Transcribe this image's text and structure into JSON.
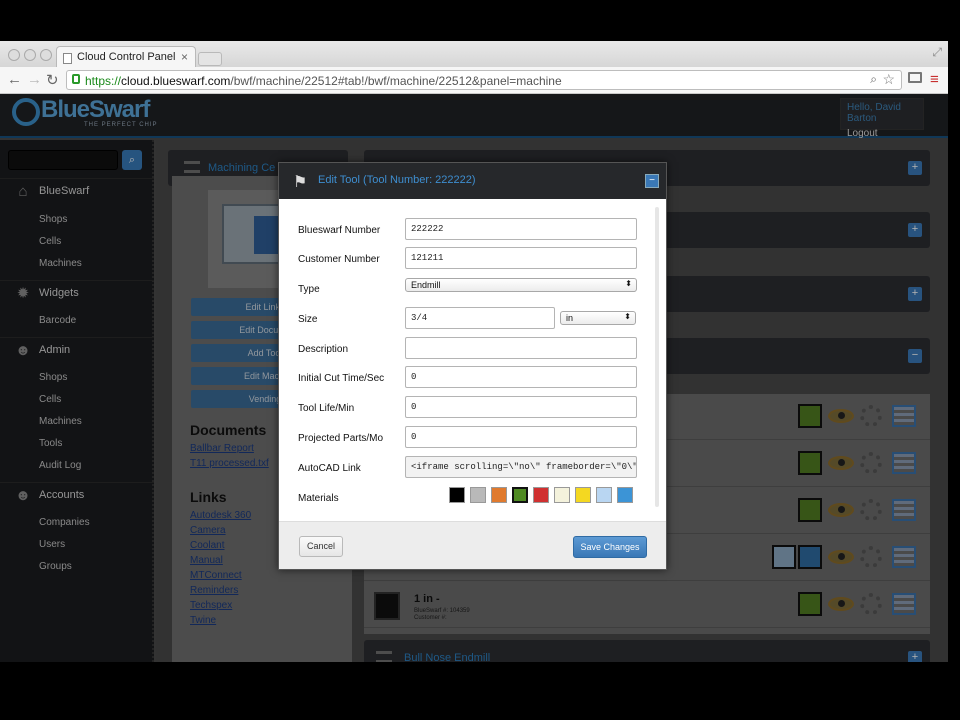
{
  "browser": {
    "tab_title": "Cloud Control Panel",
    "url_scheme": "https://",
    "url_host": "cloud.blueswarf.com",
    "url_path": "/bwf/machine/22512#tab!/bwf/machine/22512&panel=machine"
  },
  "header": {
    "logo_text": "BlueSwarf",
    "logo_tagline": "THE PERFECT CHIP",
    "greeting": "Hello, David Barton",
    "logout": "Logout"
  },
  "sidebar": {
    "sections": [
      {
        "label": "BlueSwarf",
        "icon": "home-icon",
        "items": [
          "Shops",
          "Cells",
          "Machines"
        ]
      },
      {
        "label": "Widgets",
        "icon": "gear-icon",
        "items": [
          "Barcode"
        ]
      },
      {
        "label": "Admin",
        "icon": "user-icon",
        "items": [
          "Shops",
          "Cells",
          "Machines",
          "Tools",
          "Audit Log"
        ]
      },
      {
        "label": "Accounts",
        "icon": "users-icon",
        "items": [
          "Companies",
          "Users",
          "Groups"
        ]
      }
    ]
  },
  "left_panel": {
    "title": "Machining Ce",
    "buttons": [
      "Edit Links",
      "Edit Docume",
      "Add Tool",
      "Edit Machi",
      "Vending"
    ],
    "documents_heading": "Documents",
    "documents": [
      "Ballbar Report",
      "T11 processed.txf"
    ],
    "links_heading": "Links",
    "links": [
      "Autodesk 360",
      "Camera",
      "Coolant",
      "Manual",
      "MTConnect",
      "Reminders",
      "Techspex",
      "Twine"
    ]
  },
  "tool_row": {
    "title": "1 in -",
    "number": "BlueSwarf #: 104359",
    "customer": "Customer #:"
  },
  "bottom_panel_title": "Bull Nose Endmill",
  "modal": {
    "title": "Edit Tool (Tool Number: 222222)",
    "fields": {
      "blueswarf_number": {
        "label": "Blueswarf Number",
        "value": "222222"
      },
      "customer_number": {
        "label": "Customer Number",
        "value": "121211"
      },
      "type": {
        "label": "Type",
        "value": "Endmill"
      },
      "size": {
        "label": "Size",
        "value": "3/4",
        "unit": "in"
      },
      "description": {
        "label": "Description",
        "value": ""
      },
      "initial_cut_time": {
        "label": "Initial Cut Time/Sec",
        "value": "0"
      },
      "tool_life": {
        "label": "Tool Life/Min",
        "value": "0"
      },
      "projected_parts": {
        "label": "Projected Parts/Mo",
        "value": "0"
      },
      "autocad_link": {
        "label": "AutoCAD Link",
        "value": "<iframe scrolling=\\\"no\\\" frameborder=\\\"0\\\" hspace="
      }
    },
    "materials_label": "Materials",
    "material_colors": [
      "#000000",
      "#b9b9b9",
      "#e07a2e",
      "#4f8a22",
      "#d03030",
      "#f4f2dc",
      "#f4d821",
      "#b9d6f2",
      "#3c94d6"
    ],
    "cancel_label": "Cancel",
    "save_label": "Save Changes"
  }
}
